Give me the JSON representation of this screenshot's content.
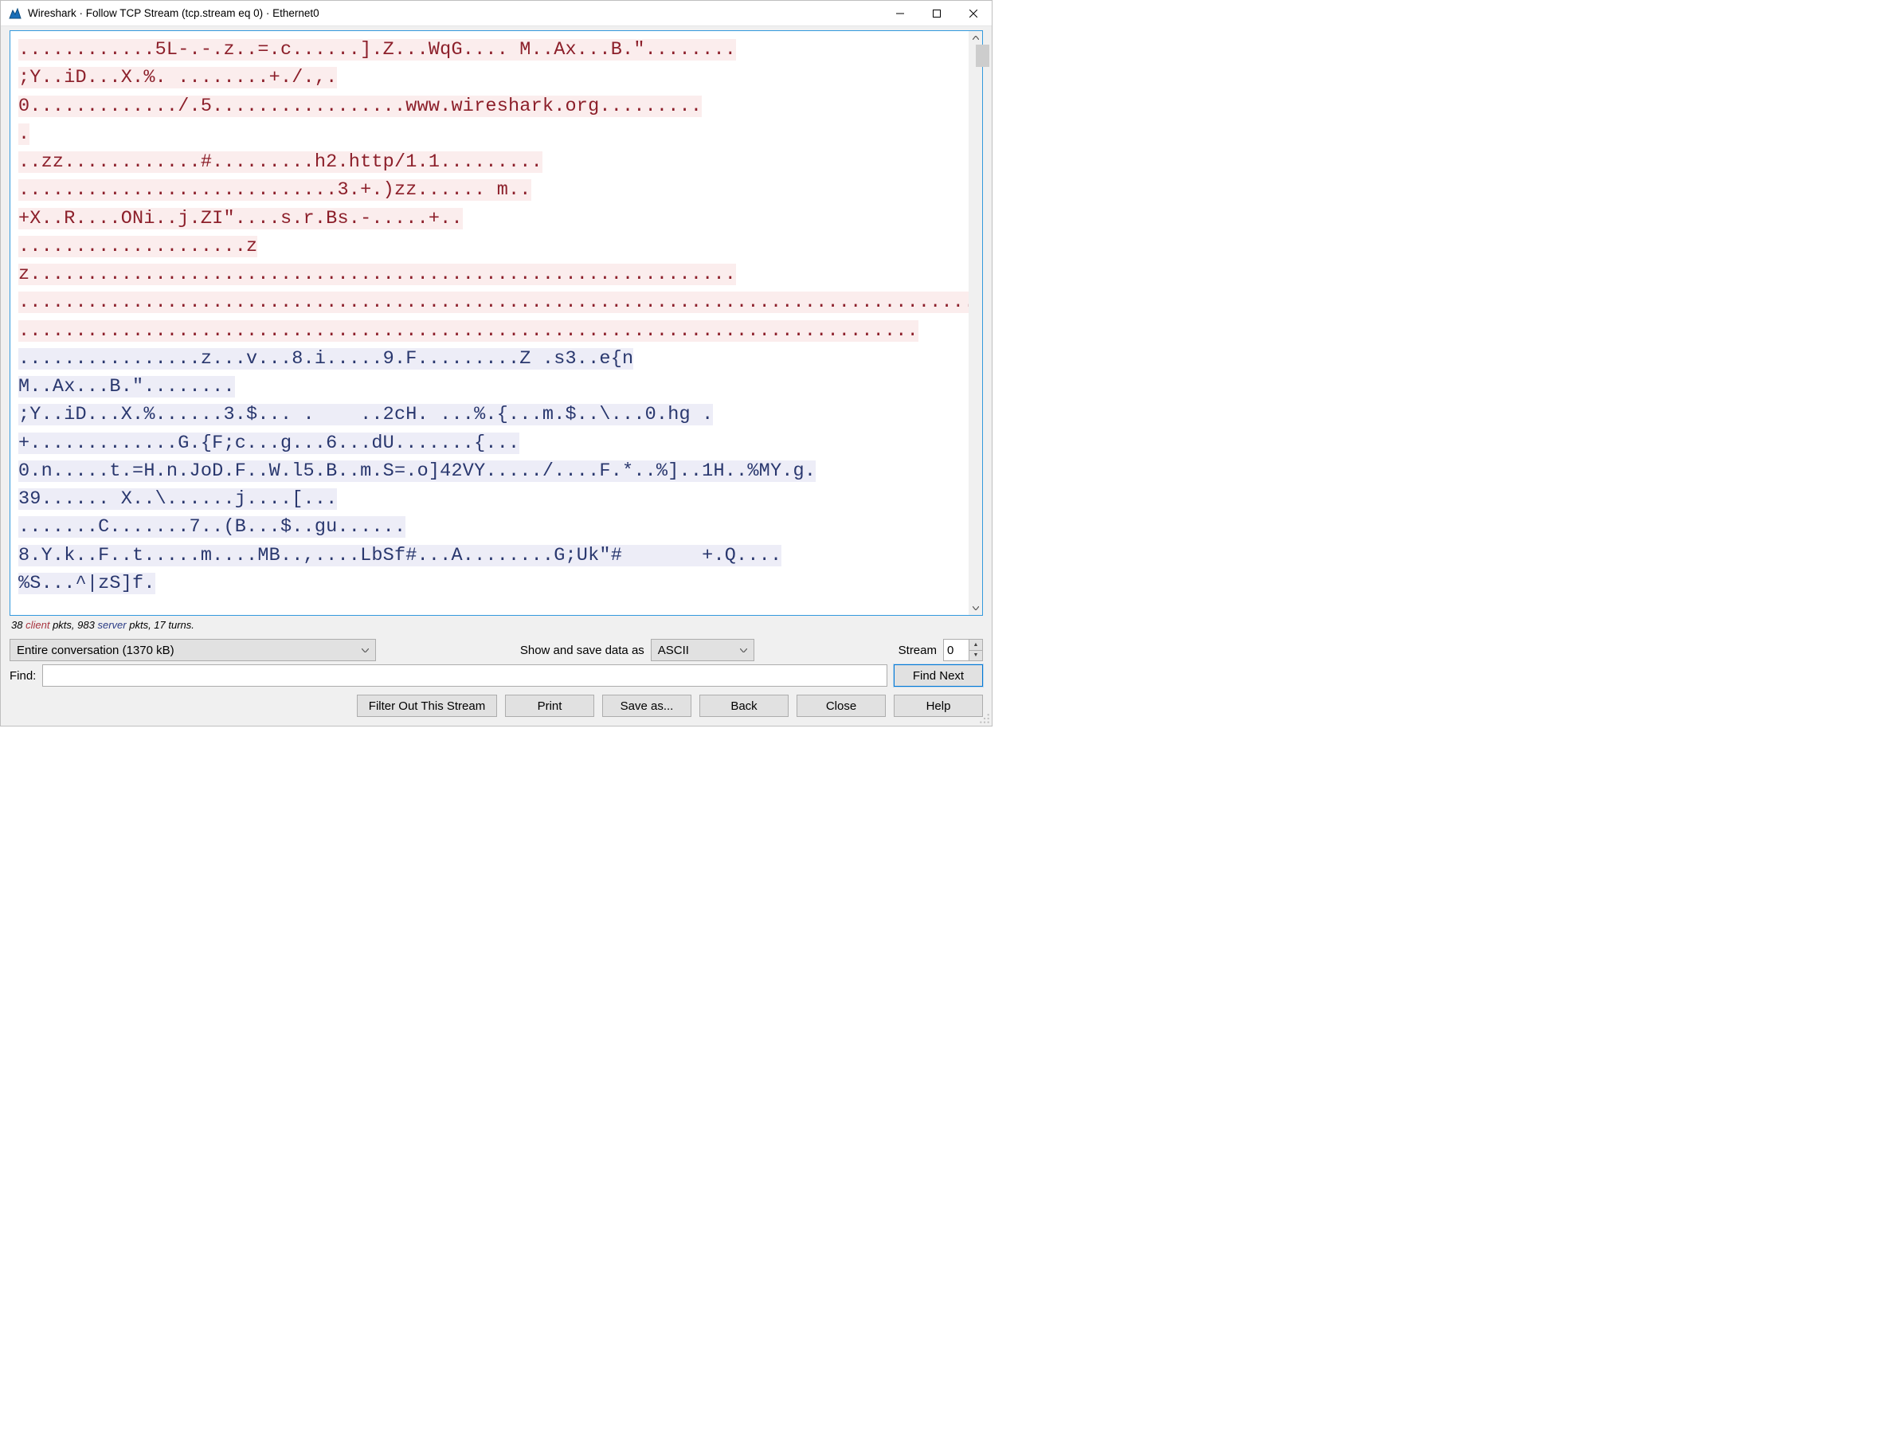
{
  "titlebar": {
    "title": "Wireshark · Follow TCP Stream (tcp.stream eq 0) · Ethernet0"
  },
  "stream_segments": [
    {
      "dir": "c",
      "text": "............5L-.-.z..=.c......].Z...WqG.... M..Ax...B.\"........"
    },
    {
      "dir": "c",
      "text": ";Y..iD...X.%. ........+./.,."
    },
    {
      "dir": "c",
      "text": "0............./.5.................www.wireshark.org........."
    },
    {
      "dir": "c",
      "text": "."
    },
    {
      "dir": "c",
      "text": "..zz............#.........h2.http/1.1........."
    },
    {
      "dir": "c",
      "text": "............................3.+.)zz...... m.."
    },
    {
      "dir": "c",
      "text": "+X..R....ONi..j.ZI\"....s.r.Bs.-.....+.."
    },
    {
      "dir": "c",
      "text": "....................zz.............................................................."
    },
    {
      "dir": "c",
      "text": "......................................................................................"
    },
    {
      "dir": "c",
      "text": "..............................................................................."
    },
    {
      "dir": "s",
      "text": "................z...v...8.i.....9.F.........Z .s3..e{n"
    },
    {
      "dir": "s",
      "text": "M..Ax...B.\"........"
    },
    {
      "dir": "s",
      "text": ";Y..iD...X.%......3.$... .    ..2cH. ...%.{...m.$..\\...0.hg ."
    },
    {
      "dir": "s",
      "text": "+.............G.{F;c...g...6...dU.......{..."
    },
    {
      "dir": "s",
      "text": "0.n.....t.=H.n.JoD.F..W.l5.B..m.S=.o]42VY...../....F.*..%]..1H..%MY.g."
    },
    {
      "dir": "s",
      "text": "39...... X..\\......j....[..."
    },
    {
      "dir": "s",
      "text": ".......C.......7..(B...$..gu......"
    },
    {
      "dir": "s",
      "text": "8.Y.k..F..t.....m....MB..,....LbSf#...A........G;Uk\"#       +.Q...."
    },
    {
      "dir": "s",
      "text": "%S...^|zS]f."
    }
  ],
  "stats": {
    "client_pkts": "38",
    "client_word": "client",
    "mid1": " pkts, ",
    "server_pkts": "983",
    "server_word": "server",
    "tail": " pkts, 17 turns."
  },
  "controls": {
    "conversation_select": "Entire conversation (1370 kB)",
    "show_save_label": "Show and save data as",
    "format_select": "ASCII",
    "stream_label": "Stream",
    "stream_value": "0",
    "find_label": "Find:",
    "find_value": "",
    "find_next": "Find Next",
    "filter_out": "Filter Out This Stream",
    "print": "Print",
    "save_as": "Save as...",
    "back": "Back",
    "close": "Close",
    "help": "Help"
  }
}
